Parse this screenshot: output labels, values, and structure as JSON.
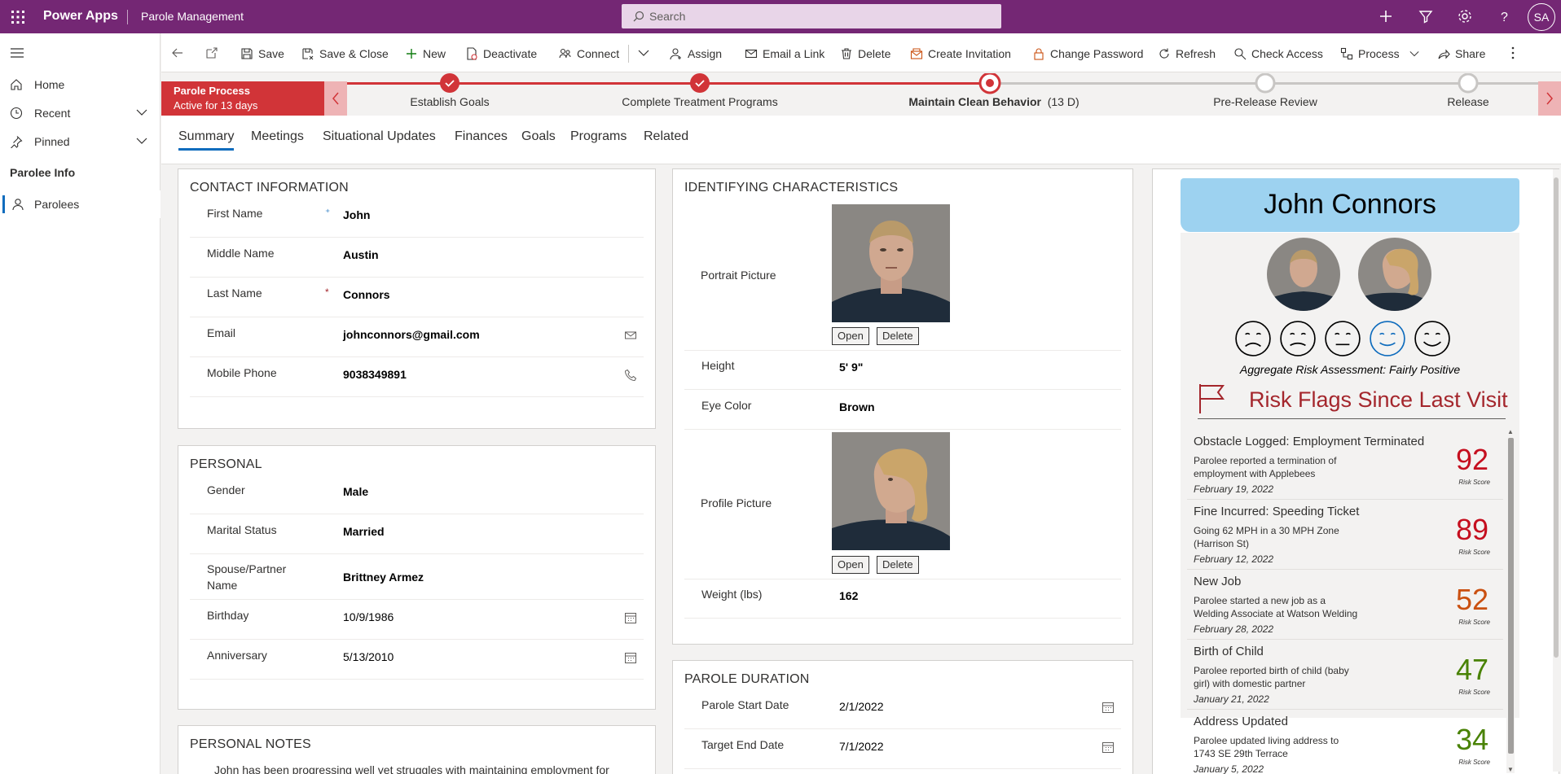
{
  "topbar": {
    "app_title": "Power Apps",
    "app_name": "Parole Management",
    "search_placeholder": "Search",
    "avatar_initials": "SA"
  },
  "sidebar": {
    "items": [
      {
        "label": "Home"
      },
      {
        "label": "Recent"
      },
      {
        "label": "Pinned"
      }
    ],
    "section_title": "Parolee Info",
    "entity_item": "Parolees"
  },
  "commandbar": {
    "save": "Save",
    "save_close": "Save & Close",
    "new": "New",
    "deactivate": "Deactivate",
    "connect": "Connect",
    "assign": "Assign",
    "email_link": "Email a Link",
    "delete": "Delete",
    "create_invitation": "Create Invitation",
    "change_password": "Change Password",
    "refresh": "Refresh",
    "check_access": "Check Access",
    "process": "Process",
    "share": "Share"
  },
  "process": {
    "name": "Parole Process",
    "active_for": "Active for 13 days",
    "stages": [
      {
        "label": "Establish Goals",
        "state": "done"
      },
      {
        "label": "Complete Treatment Programs",
        "state": "done"
      },
      {
        "label": "Maintain Clean Behavior",
        "duration": "(13 D)",
        "state": "active"
      },
      {
        "label": "Pre-Release Review",
        "state": "todo"
      },
      {
        "label": "Release",
        "state": "todo"
      }
    ]
  },
  "tabs": [
    "Summary",
    "Meetings",
    "Situational Updates",
    "Finances",
    "Goals",
    "Programs",
    "Related"
  ],
  "contact": {
    "title": "CONTACT INFORMATION",
    "first_name_label": "First Name",
    "first_name": "John",
    "middle_name_label": "Middle Name",
    "middle_name": "Austin",
    "last_name_label": "Last Name",
    "last_name": "Connors",
    "email_label": "Email",
    "email": "johnconnors@gmail.com",
    "mobile_label": "Mobile Phone",
    "mobile": "9038349891"
  },
  "personal": {
    "title": "PERSONAL",
    "gender_label": "Gender",
    "gender": "Male",
    "marital_label": "Marital Status",
    "marital": "Married",
    "spouse_label": "Spouse/Partner Name",
    "spouse": "Brittney Armez",
    "birthday_label": "Birthday",
    "birthday": "10/9/1986",
    "anniversary_label": "Anniversary",
    "anniversary": "5/13/2010"
  },
  "notes": {
    "title": "PERSONAL NOTES",
    "text": "John has been progressing well yet struggles with maintaining employment for"
  },
  "identifying": {
    "title": "IDENTIFYING CHARACTERISTICS",
    "portrait_label": "Portrait Picture",
    "open": "Open",
    "delete": "Delete",
    "height_label": "Height",
    "height": "5' 9\"",
    "eye_label": "Eye Color",
    "eye": "Brown",
    "profile_label": "Profile Picture",
    "weight_label": "Weight (lbs)",
    "weight": "162"
  },
  "duration": {
    "title": "PAROLE DURATION",
    "start_label": "Parole Start Date",
    "start": "2/1/2022",
    "end_label": "Target End Date",
    "end": "7/1/2022"
  },
  "profile": {
    "name": "John Connors",
    "risk_assessment": "Aggregate Risk Assessment: Fairly Positive",
    "selected_mood_index": 3,
    "flags_title": "Risk Flags Since Last Visit",
    "score_label": "Risk Score",
    "colors": {
      "high": "#c50f1f",
      "mid": "#ca5010",
      "low": "#498205",
      "header": "#9dd2f0",
      "selected": "#0f6cbd"
    },
    "flags": [
      {
        "title": "Obstacle Logged: Employment Terminated",
        "desc1": "Parolee reported a termination of",
        "desc2": "employment with Applebees",
        "date": "February 19, 2022",
        "score": "92",
        "level": "high"
      },
      {
        "title": "Fine Incurred: Speeding Ticket",
        "desc1": "Going 62 MPH in a 30 MPH Zone",
        "desc2": "(Harrison St)",
        "date": "February 12, 2022",
        "score": "89",
        "level": "high"
      },
      {
        "title": "New Job",
        "desc1": "Parolee started a new job as a",
        "desc2": "Welding Associate at Watson Welding",
        "date": "February 28, 2022",
        "score": "52",
        "level": "mid"
      },
      {
        "title": "Birth of Child",
        "desc1": "Parolee reported birth of child (baby",
        "desc2": "girl) with domestic partner",
        "date": "January 21, 2022",
        "score": "47",
        "level": "low"
      },
      {
        "title": "Address Updated",
        "desc1": "Parolee updated living address to",
        "desc2": "1743 SE 29th Terrace",
        "date": "January 5, 2022",
        "score": "34",
        "level": "low"
      }
    ]
  }
}
